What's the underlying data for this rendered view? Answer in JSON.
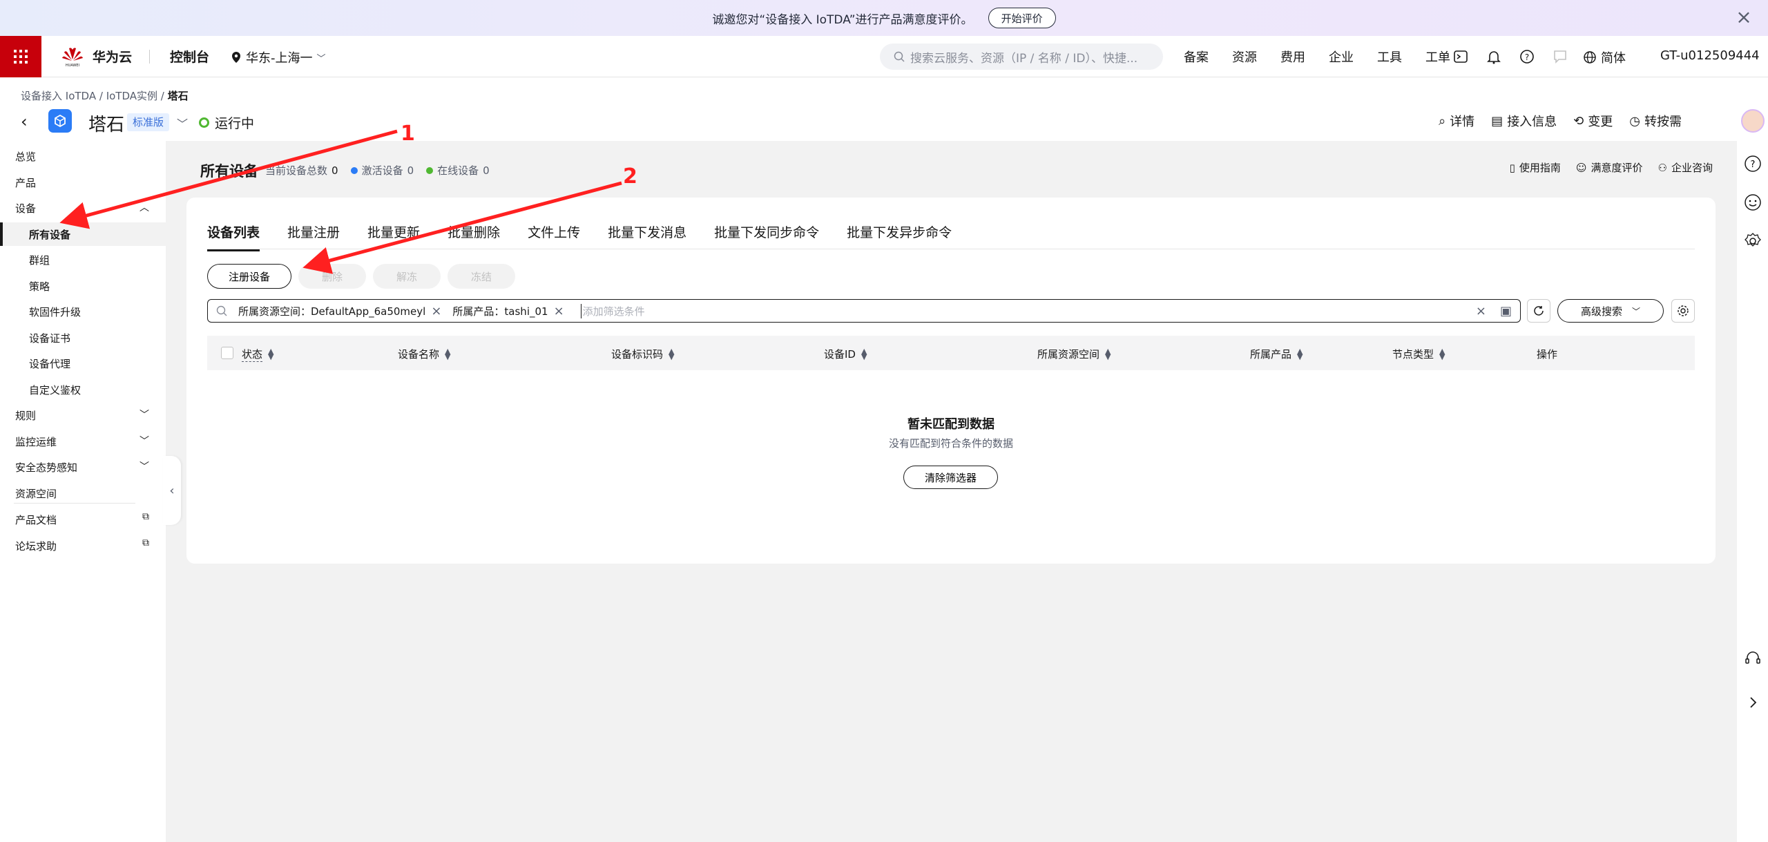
{
  "banner": {
    "text": "诚邀您对“设备接入 IoTDA”进行产品满意度评价。",
    "button": "开始评价"
  },
  "topnav": {
    "brand": "华为云",
    "brand_sub": "HUAWEI",
    "console": "控制台",
    "region": "华东-上海一",
    "search_placeholder": "搜索云服务、资源（IP / 名称 / ID）、快捷...",
    "links": [
      "备案",
      "资源",
      "费用",
      "企业",
      "工具",
      "工单"
    ],
    "lang": "简体",
    "user": "GT-u012509444"
  },
  "breadcrumb": {
    "items": [
      "设备接入 IoTDA",
      "IoTDA实例"
    ],
    "current": "塔石",
    "sep": " / "
  },
  "instance": {
    "name": "塔石",
    "edition": "标准版",
    "status": "运行中"
  },
  "header_actions": [
    "详情",
    "接入信息",
    "变更",
    "转按需"
  ],
  "sidebar": {
    "overview": "总览",
    "product": "产品",
    "device": "设备",
    "device_sub": [
      "所有设备",
      "群组",
      "策略",
      "软固件升级",
      "设备证书",
      "设备代理",
      "自定义鉴权"
    ],
    "rules": "规则",
    "monitor": "监控运维",
    "security": "安全态势感知",
    "resource_space": "资源空间",
    "docs": "产品文档",
    "forum": "论坛求助"
  },
  "main": {
    "title": "所有设备",
    "total_label": "当前设备总数",
    "total": "0",
    "active_label": "激活设备",
    "active": "0",
    "online_label": "在线设备",
    "online": "0",
    "links": [
      "使用指南",
      "满意度评价",
      "企业咨询"
    ]
  },
  "tabs": [
    "设备列表",
    "批量注册",
    "批量更新",
    "批量删除",
    "文件上传",
    "批量下发消息",
    "批量下发同步命令",
    "批量下发异步命令"
  ],
  "buttons": {
    "register": "注册设备",
    "delete": "删除",
    "unfreeze": "解冻",
    "freeze": "冻结"
  },
  "filter": {
    "chips": [
      "所属资源空间：DefaultApp_6a50meyl",
      "所属产品：tashi_01"
    ],
    "placeholder": "添加筛选条件",
    "advanced": "高级搜索"
  },
  "table": {
    "columns": [
      "状态",
      "设备名称",
      "设备标识码",
      "设备ID",
      "所属资源空间",
      "所属产品",
      "节点类型",
      "操作"
    ]
  },
  "empty": {
    "title": "暂未匹配到数据",
    "subtitle": "没有匹配到符合条件的数据",
    "clear": "清除筛选器"
  },
  "annotations": {
    "one": "1",
    "two": "2"
  },
  "colors": {
    "brand_red": "#c7000b",
    "annotation_red": "#ff2020",
    "running_green": "#50b832",
    "active_blue": "#2b7cf6"
  }
}
